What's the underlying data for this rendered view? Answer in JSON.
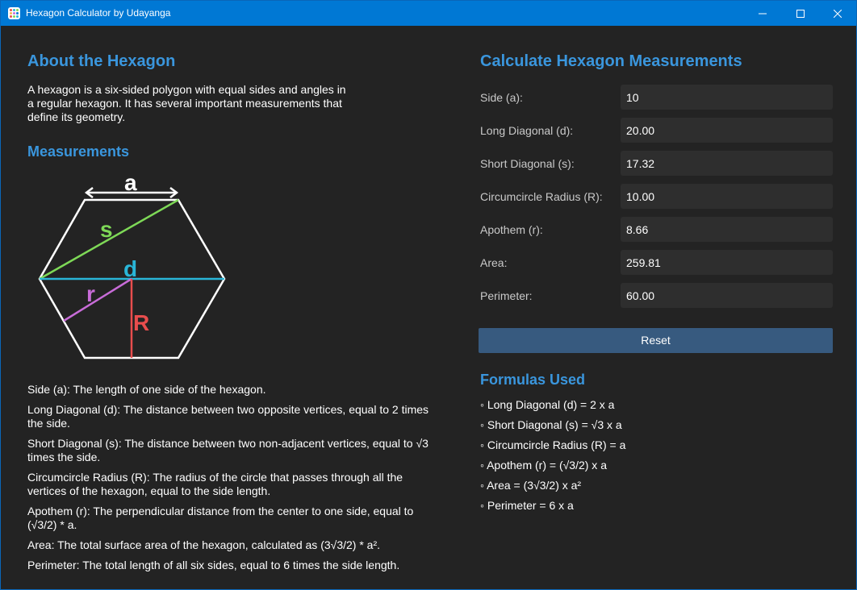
{
  "window": {
    "title": "Hexagon Calculator by Udayanga",
    "controls": {
      "minimize": "—",
      "maximize": "☐",
      "close": "✕"
    }
  },
  "about": {
    "heading": "About the Hexagon",
    "text": "A hexagon is a six-sided polygon with equal sides and angles in a regular hexagon. It has several important measurements that define its geometry."
  },
  "measurements": {
    "heading": "Measurements",
    "diagram_labels": {
      "a": "a",
      "s": "s",
      "d": "d",
      "r": "r",
      "R": "R"
    },
    "colors": {
      "hexagon": "#ffffff",
      "a": "#ffffff",
      "s": "#7ed957",
      "d": "#29b6d8",
      "r": "#c86cd8",
      "R": "#e84d4d"
    },
    "descriptions": [
      "Side (a): The length of one side of the hexagon.",
      "Long Diagonal (d): The distance between two opposite vertices, equal to 2 times the side.",
      "Short Diagonal (s): The distance between two non-adjacent vertices, equal to √3 times the side.",
      "Circumcircle Radius (R): The radius of the circle that passes through all the vertices of the hexagon, equal to the side length.",
      "Apothem (r): The perpendicular distance from the center to one side, equal to (√3/2) * a.",
      "Area: The total surface area of the hexagon, calculated as (3√3/2) * a².",
      "Perimeter: The total length of all six sides, equal to 6 times the side length."
    ]
  },
  "calculator": {
    "heading": "Calculate Hexagon Measurements",
    "fields": [
      {
        "label": "Side (a):",
        "value": "10"
      },
      {
        "label": "Long Diagonal (d):",
        "value": "20.00"
      },
      {
        "label": "Short Diagonal (s):",
        "value": "17.32"
      },
      {
        "label": "Circumcircle Radius (R):",
        "value": "10.00"
      },
      {
        "label": "Apothem (r):",
        "value": "8.66"
      },
      {
        "label": "Area:",
        "value": "259.81"
      },
      {
        "label": "Perimeter:",
        "value": "60.00"
      }
    ],
    "reset_label": "Reset"
  },
  "formulas": {
    "heading": "Formulas Used",
    "items": [
      "◦ Long Diagonal (d) = 2 x a",
      "◦ Short Diagonal (s) = √3 x a",
      "◦ Circumcircle Radius (R) = a",
      "◦ Apothem (r) = (√3/2) x a",
      "◦ Area = (3√3/2) x a²",
      "◦ Perimeter = 6 x a"
    ]
  },
  "theme": {
    "accent": "#3a96dd",
    "titlebar": "#0078d4",
    "background": "#232323",
    "button": "#375a7f"
  }
}
